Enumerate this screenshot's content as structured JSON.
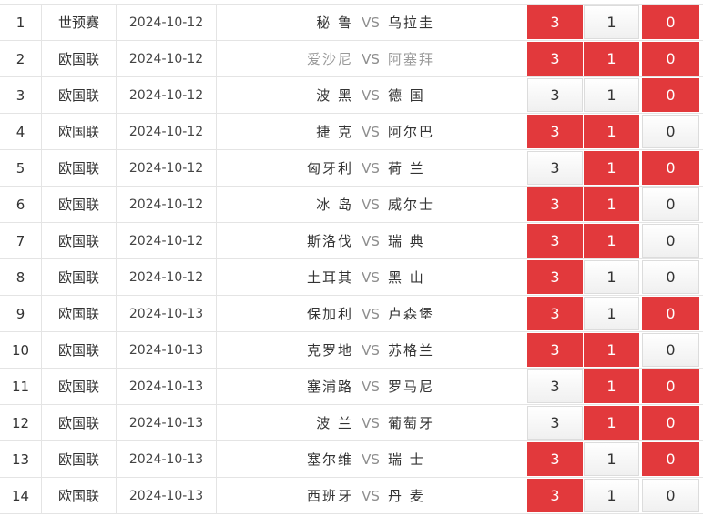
{
  "vs_label": "VS",
  "colors": {
    "accent_red": "#e2393c",
    "border": "#e4e4e4",
    "muted": "#999999"
  },
  "rows": [
    {
      "idx": "1",
      "league": "世预赛",
      "date": "2024-10-12",
      "home": "秘 鲁",
      "away": "乌拉圭",
      "dim": false,
      "opts": [
        {
          "v": "3",
          "red": true
        },
        {
          "v": "1",
          "red": false
        },
        {
          "v": "0",
          "red": true
        }
      ]
    },
    {
      "idx": "2",
      "league": "欧国联",
      "date": "2024-10-12",
      "home": "爱沙尼",
      "away": "阿塞拜",
      "dim": true,
      "opts": [
        {
          "v": "3",
          "red": true
        },
        {
          "v": "1",
          "red": true
        },
        {
          "v": "0",
          "red": true
        }
      ]
    },
    {
      "idx": "3",
      "league": "欧国联",
      "date": "2024-10-12",
      "home": "波 黑",
      "away": "德 国",
      "dim": false,
      "opts": [
        {
          "v": "3",
          "red": false
        },
        {
          "v": "1",
          "red": false
        },
        {
          "v": "0",
          "red": true
        }
      ]
    },
    {
      "idx": "4",
      "league": "欧国联",
      "date": "2024-10-12",
      "home": "捷 克",
      "away": "阿尔巴",
      "dim": false,
      "opts": [
        {
          "v": "3",
          "red": true
        },
        {
          "v": "1",
          "red": true
        },
        {
          "v": "0",
          "red": false
        }
      ]
    },
    {
      "idx": "5",
      "league": "欧国联",
      "date": "2024-10-12",
      "home": "匈牙利",
      "away": "荷 兰",
      "dim": false,
      "opts": [
        {
          "v": "3",
          "red": false
        },
        {
          "v": "1",
          "red": true
        },
        {
          "v": "0",
          "red": true
        }
      ]
    },
    {
      "idx": "6",
      "league": "欧国联",
      "date": "2024-10-12",
      "home": "冰 岛",
      "away": "威尔士",
      "dim": false,
      "opts": [
        {
          "v": "3",
          "red": true
        },
        {
          "v": "1",
          "red": true
        },
        {
          "v": "0",
          "red": false
        }
      ]
    },
    {
      "idx": "7",
      "league": "欧国联",
      "date": "2024-10-12",
      "home": "斯洛伐",
      "away": "瑞 典",
      "dim": false,
      "opts": [
        {
          "v": "3",
          "red": true
        },
        {
          "v": "1",
          "red": true
        },
        {
          "v": "0",
          "red": false
        }
      ]
    },
    {
      "idx": "8",
      "league": "欧国联",
      "date": "2024-10-12",
      "home": "土耳其",
      "away": "黑 山",
      "dim": false,
      "opts": [
        {
          "v": "3",
          "red": true
        },
        {
          "v": "1",
          "red": false
        },
        {
          "v": "0",
          "red": false
        }
      ]
    },
    {
      "idx": "9",
      "league": "欧国联",
      "date": "2024-10-13",
      "home": "保加利",
      "away": "卢森堡",
      "dim": false,
      "opts": [
        {
          "v": "3",
          "red": true
        },
        {
          "v": "1",
          "red": false
        },
        {
          "v": "0",
          "red": true
        }
      ]
    },
    {
      "idx": "10",
      "league": "欧国联",
      "date": "2024-10-13",
      "home": "克罗地",
      "away": "苏格兰",
      "dim": false,
      "opts": [
        {
          "v": "3",
          "red": true
        },
        {
          "v": "1",
          "red": true
        },
        {
          "v": "0",
          "red": false
        }
      ]
    },
    {
      "idx": "11",
      "league": "欧国联",
      "date": "2024-10-13",
      "home": "塞浦路",
      "away": "罗马尼",
      "dim": false,
      "opts": [
        {
          "v": "3",
          "red": false
        },
        {
          "v": "1",
          "red": true
        },
        {
          "v": "0",
          "red": true
        }
      ]
    },
    {
      "idx": "12",
      "league": "欧国联",
      "date": "2024-10-13",
      "home": "波 兰",
      "away": "葡萄牙",
      "dim": false,
      "opts": [
        {
          "v": "3",
          "red": false
        },
        {
          "v": "1",
          "red": true
        },
        {
          "v": "0",
          "red": true
        }
      ]
    },
    {
      "idx": "13",
      "league": "欧国联",
      "date": "2024-10-13",
      "home": "塞尔维",
      "away": "瑞 士",
      "dim": false,
      "opts": [
        {
          "v": "3",
          "red": true
        },
        {
          "v": "1",
          "red": false
        },
        {
          "v": "0",
          "red": true
        }
      ]
    },
    {
      "idx": "14",
      "league": "欧国联",
      "date": "2024-10-13",
      "home": "西班牙",
      "away": "丹 麦",
      "dim": false,
      "opts": [
        {
          "v": "3",
          "red": true
        },
        {
          "v": "1",
          "red": false
        },
        {
          "v": "0",
          "red": false
        }
      ]
    }
  ]
}
